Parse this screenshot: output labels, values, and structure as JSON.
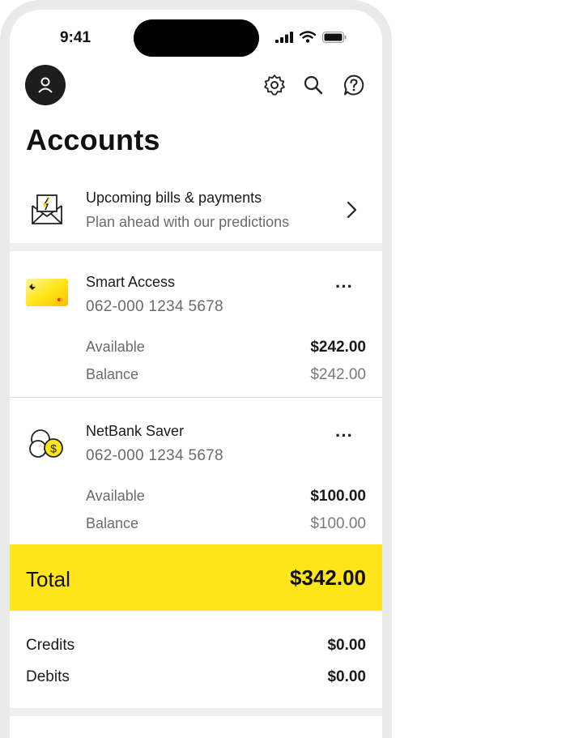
{
  "status": {
    "time": "9:41"
  },
  "header": {
    "title": "Accounts"
  },
  "bills": {
    "title": "Upcoming bills & payments",
    "subtitle": "Plan ahead with our predictions"
  },
  "accounts": [
    {
      "name": "Smart Access",
      "number": "062-000 1234 5678",
      "available_label": "Available",
      "available": "$242.00",
      "balance_label": "Balance",
      "balance": "$242.00"
    },
    {
      "name": "NetBank Saver",
      "number": "062-000 1234 5678",
      "available_label": "Available",
      "available": "$100.00",
      "balance_label": "Balance",
      "balance": "$100.00"
    }
  ],
  "total": {
    "label": "Total",
    "value": "$342.00"
  },
  "summary": {
    "credits_label": "Credits",
    "credits": "$0.00",
    "debits_label": "Debits",
    "debits": "$0.00"
  },
  "colors": {
    "accent": "#ffe51b",
    "text": "#1a1a1a",
    "muted": "#6b6b6b"
  },
  "icons": [
    "profile-icon",
    "gear-icon",
    "search-icon",
    "help-icon",
    "bills-envelope-icon",
    "chevron-right-icon",
    "card-icon",
    "coins-icon",
    "more-icon"
  ]
}
